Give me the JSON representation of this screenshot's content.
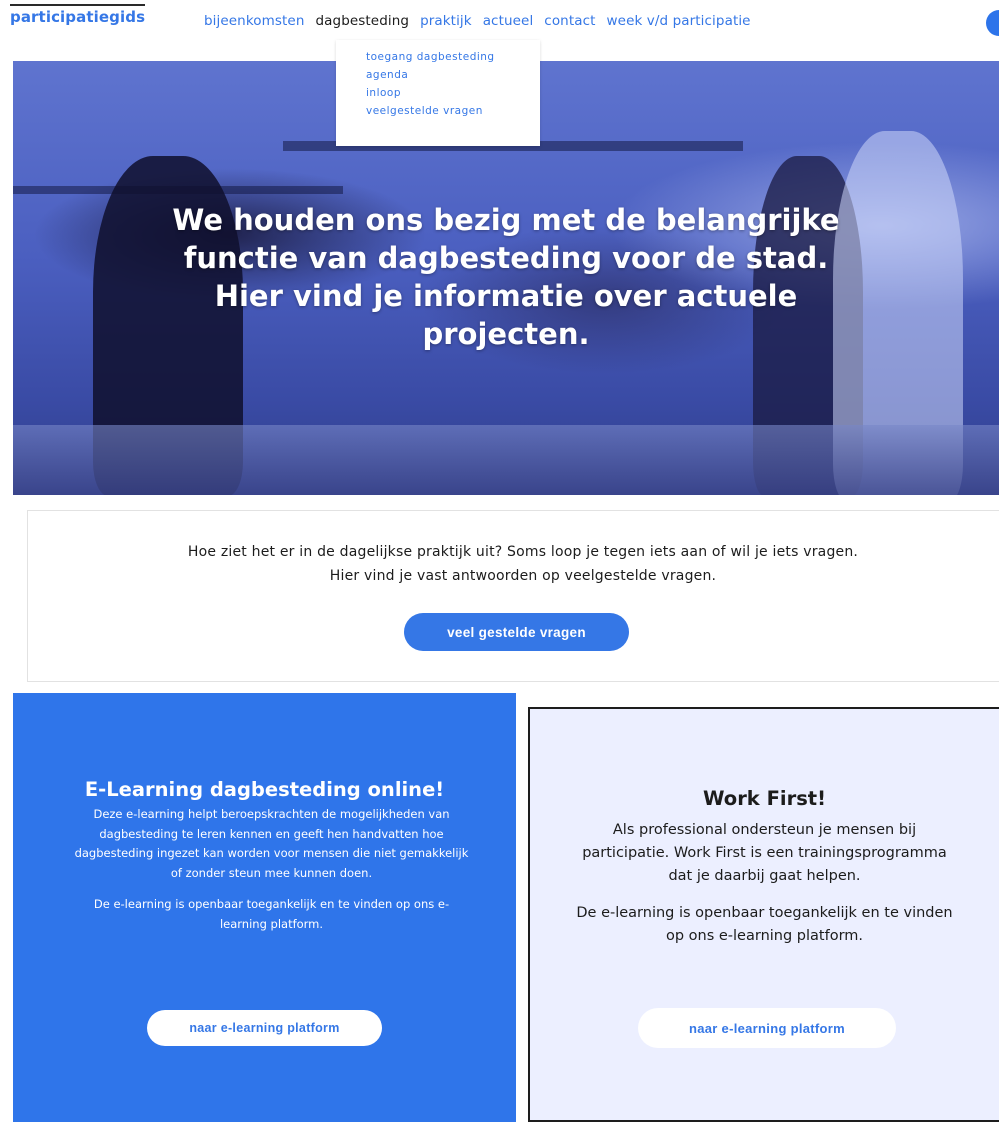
{
  "header": {
    "logo": "participatiegids",
    "nav": [
      {
        "label": "bijeenkomsten"
      },
      {
        "label": "dagbesteding",
        "active": true
      },
      {
        "label": "praktijk"
      },
      {
        "label": "actueel"
      },
      {
        "label": "contact"
      },
      {
        "label": "week v/d participatie"
      }
    ],
    "dropdown": [
      "toegang dagbesteding",
      "agenda",
      "inloop",
      "veelgestelde vragen"
    ]
  },
  "hero": {
    "title": "We houden ons bezig met de belangrijke functie van dagbesteding voor de stad. Hier vind je informatie over actuele projecten."
  },
  "faq": {
    "text": "Hoe ziet het er in de dagelijkse praktijk uit? Soms loop je tegen iets aan of wil je iets vragen. Hier vind je vast antwoorden op veelgestelde vragen.",
    "button": "veel gestelde vragen"
  },
  "cards": {
    "elearning": {
      "title": "E-Learning dagbesteding online!",
      "paragraph1": "Deze e-learning helpt beroepskrachten de mogelijkheden van dagbesteding te leren kennen en geeft hen handvatten hoe dagbesteding ingezet kan worden voor mensen die niet gemakkelijk of zonder steun mee kunnen doen.",
      "paragraph2": "De e-learning is openbaar toegankelijk en te vinden op ons e-learning platform.",
      "button": "naar e-learning platform"
    },
    "workfirst": {
      "title": "Work First!",
      "paragraph1": "Als professional ondersteun je mensen bij participatie. Work First is een trainingsprogramma dat je daarbij gaat helpen.",
      "paragraph2": "De e-learning is openbaar toegankelijk en te vinden op ons e-learning platform.",
      "button": "naar e-learning platform"
    }
  },
  "colors": {
    "accent": "#3577e6",
    "card_left_bg": "#2f75ea",
    "card_right_bg": "#ecefff"
  }
}
